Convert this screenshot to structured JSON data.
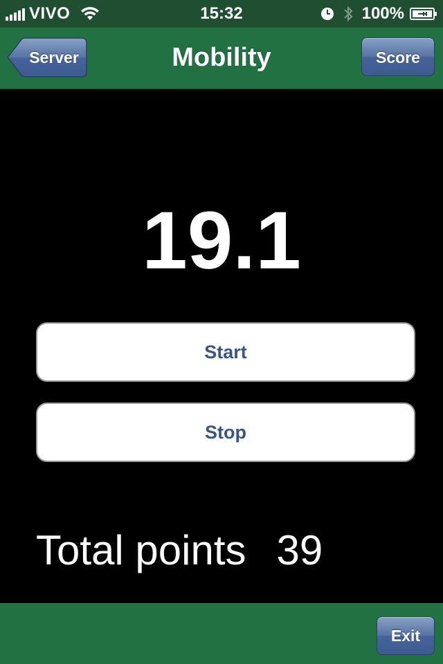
{
  "status_bar": {
    "carrier": "VIVO",
    "time": "15:32",
    "battery_percent": "100%",
    "signal_bars": 5,
    "icons": [
      "signal-icon",
      "wifi-icon",
      "clock-icon",
      "bluetooth-icon",
      "battery-charging-icon"
    ]
  },
  "nav_bar": {
    "title": "Mobility",
    "back_label": "Server",
    "right_label": "Score",
    "background_color": "#217143"
  },
  "main": {
    "timer_value": "19.1",
    "start_label": "Start",
    "stop_label": "Stop",
    "total_label": "Total points",
    "total_value": "39",
    "button_text_color": "#385489"
  },
  "toolbar": {
    "exit_label": "Exit",
    "button_color": "#4a679c"
  }
}
